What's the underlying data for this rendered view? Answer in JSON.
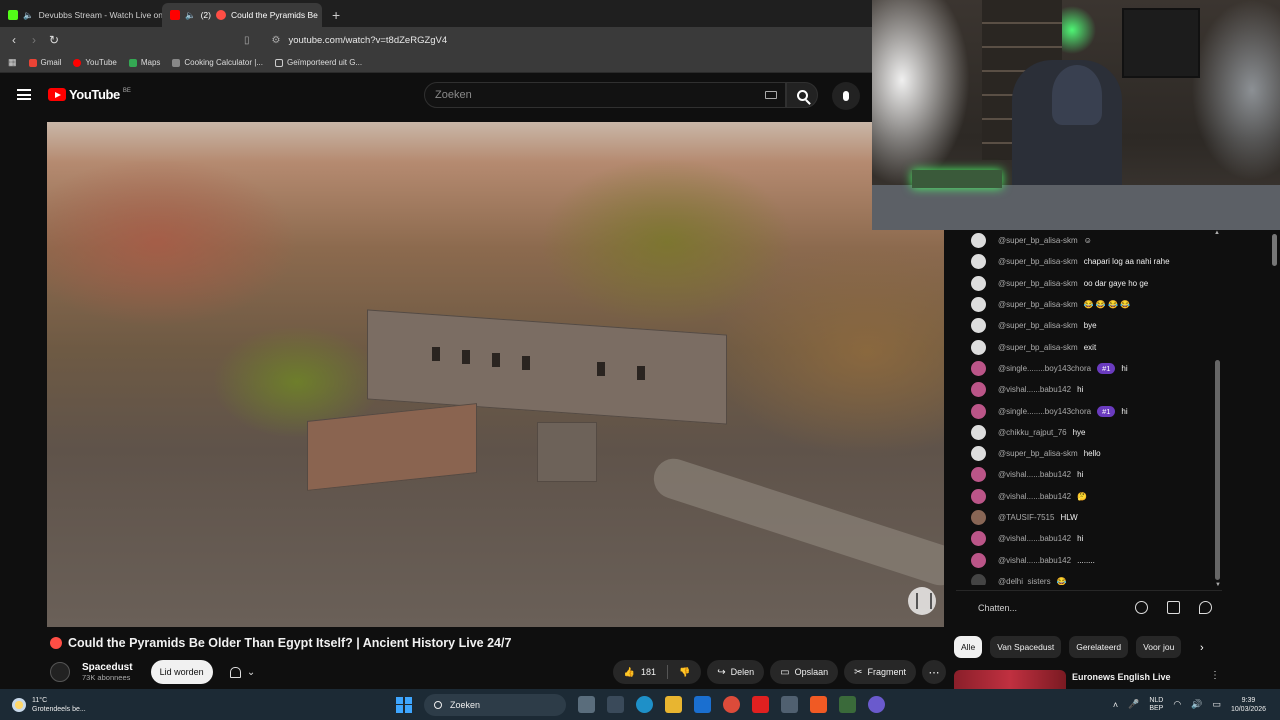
{
  "browser": {
    "tabs": [
      {
        "title": "Devubbs Stream - Watch Live on"
      },
      {
        "title": "Could the Pyramids Be",
        "audio_badge": "(2)"
      }
    ],
    "new_tab": "+",
    "url": "youtube.com/watch?v=t8dZeRGZgV4",
    "bookmarks": [
      "Gmail",
      "YouTube",
      "Maps",
      "Cooking Calculator |...",
      "Geïmporteerd uit G..."
    ]
  },
  "youtube": {
    "logo_text": "YouTube",
    "country_code": "BE",
    "search_placeholder": "Zoeken"
  },
  "video": {
    "title": "Could the Pyramids Be Older Than Egypt Itself? | Ancient History Live 24/7",
    "channel": "Spacedust",
    "subscribers": "73K abonnees",
    "join_label": "Lid worden",
    "likes": "181",
    "share_label": "Delen",
    "save_label": "Opslaan",
    "clip_label": "Fragment"
  },
  "chat": {
    "messages": [
      {
        "author": "@super_bp_alisa-skm",
        "text": "☺"
      },
      {
        "author": "@super_bp_alisa-skm",
        "text": "chapari log aa nahi rahe"
      },
      {
        "author": "@super_bp_alisa-skm",
        "text": "oo dar gaye ho ge"
      },
      {
        "author": "@super_bp_alisa-skm",
        "text": "😂 😂 😂 😂"
      },
      {
        "author": "@super_bp_alisa-skm",
        "text": "bye"
      },
      {
        "author": "@super_bp_alisa-skm",
        "text": "exit"
      },
      {
        "author": "@single........boy143chora",
        "badge": "#1",
        "text": "hi"
      },
      {
        "author": "@vishal......babu142",
        "text": "hi"
      },
      {
        "author": "@single........boy143chora",
        "badge": "#1",
        "text": "hi"
      },
      {
        "author": "@chikku_rajput_76",
        "text": "hye"
      },
      {
        "author": "@super_bp_alisa-skm",
        "text": "hello"
      },
      {
        "author": "@vishal......babu142",
        "text": "hi"
      },
      {
        "author": "@vishal......babu142",
        "text": "🤔"
      },
      {
        "author": "@TAUSIF-7515",
        "text": "HLW"
      },
      {
        "author": "@vishal......babu142",
        "text": "hi"
      },
      {
        "author": "@vishal......babu142",
        "text": "........"
      },
      {
        "author": "@delhi_sisters",
        "text": "😂"
      }
    ],
    "input_placeholder": "Chatten..."
  },
  "chips": [
    "Alle",
    "Van Spacedust",
    "Gerelateerd",
    "Voor jou"
  ],
  "recommendation": {
    "title": "Euronews English Live"
  },
  "taskbar": {
    "weather_temp": "11°C",
    "weather_desc": "Grotendeels be...",
    "search_label": "Zoeken",
    "lang_line1": "NLD",
    "lang_line2": "BEP",
    "time": "9:39",
    "date": "10/03/2026"
  }
}
